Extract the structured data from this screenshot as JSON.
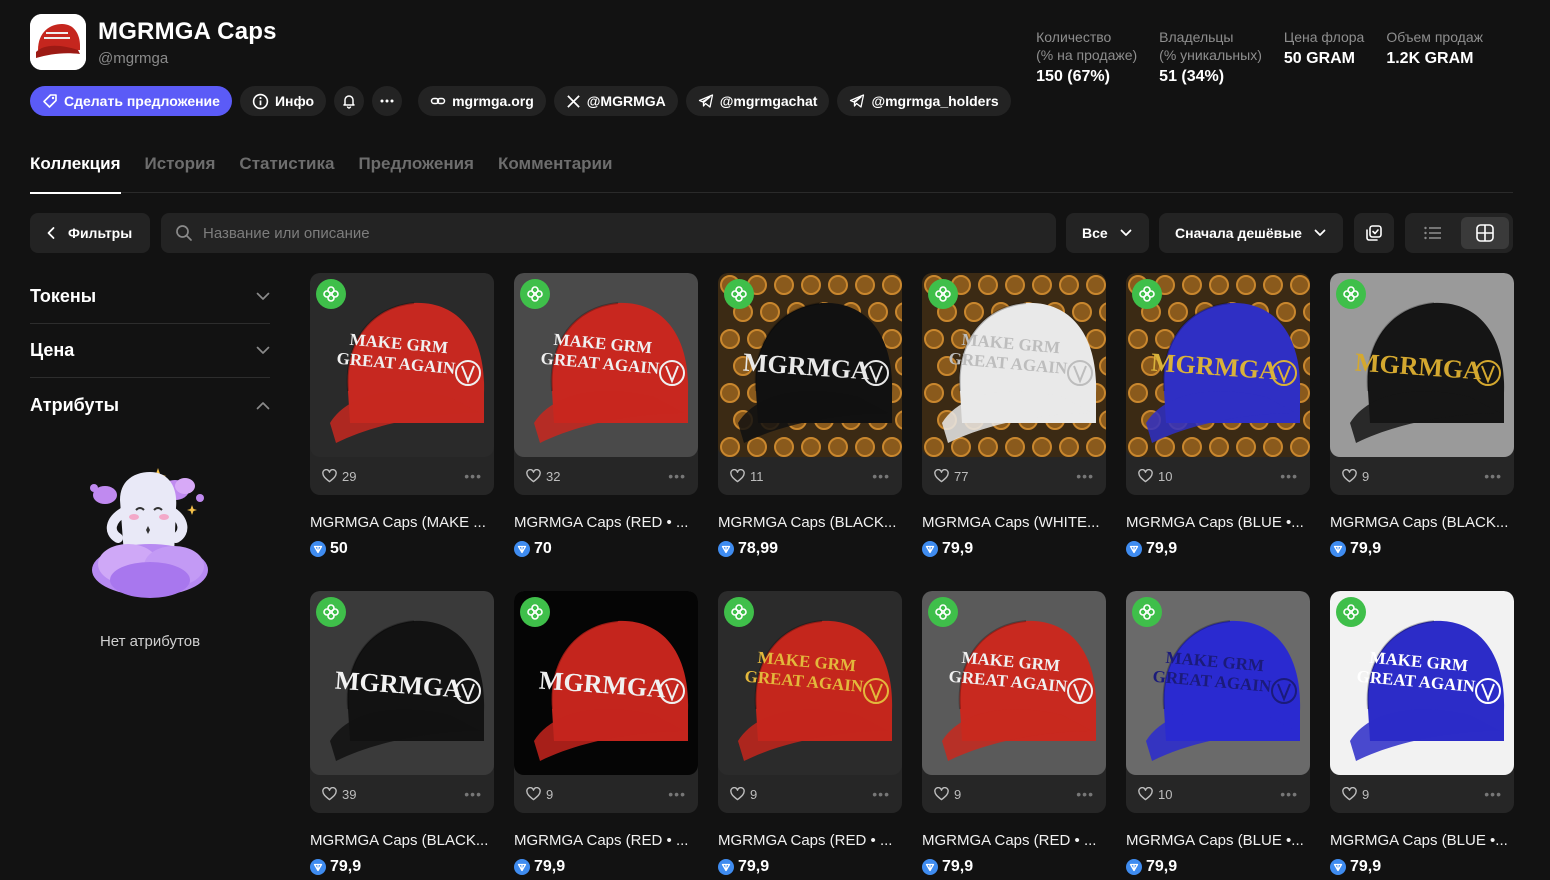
{
  "collection": {
    "name": "MGRMGA Caps",
    "handle": "@mgrmga",
    "logo_icon": "red-cap-logo"
  },
  "stats": [
    {
      "label": "Количество\n(% на продаже)",
      "value": "150 (67%)"
    },
    {
      "label": "Владельцы\n(% уникальных)",
      "value": "51 (34%)"
    },
    {
      "label": "Цена флора",
      "value": "50 GRAM"
    },
    {
      "label": "Объем продаж",
      "value": "1.2K GRAM"
    }
  ],
  "actions": {
    "offer": "Сделать предложение",
    "info": "Инфо",
    "links": [
      {
        "label": "mgrmga.org",
        "icon": "link-icon"
      },
      {
        "label": "@MGRMGA",
        "icon": "x-icon"
      },
      {
        "label": "@mgrmgachat",
        "icon": "telegram-icon"
      },
      {
        "label": "@mgrmga_holders",
        "icon": "telegram-icon"
      }
    ]
  },
  "tabs": [
    "Коллекция",
    "История",
    "Статистика",
    "Предложения",
    "Комментарии"
  ],
  "toolbar": {
    "filters": "Фильтры",
    "search_placeholder": "Название или описание",
    "filter_all": "Все",
    "sort": "Сначала дешёвые"
  },
  "sidebar": {
    "sections": [
      "Токены",
      "Цена",
      "Атрибуты"
    ],
    "empty_label": "Нет атрибутов"
  },
  "colors": {
    "accent": "#5b5bf7",
    "badge": "#3fbf4a",
    "ton": "#3f8cf0",
    "background": "#121212",
    "surface": "#232323"
  },
  "items": [
    {
      "name": "MGRMGA Caps (MAKE ...",
      "likes": "29",
      "price": "50",
      "cap": "#c62820",
      "bg": "#2a2a2a",
      "text": "MAKE GRM GREAT AGAIN",
      "textColor": "#f0f0f0",
      "pattern": false
    },
    {
      "name": "MGRMGA Caps (RED • ...",
      "likes": "32",
      "price": "70",
      "cap": "#c8271f",
      "bg": "#4a4a4a",
      "text": "MAKE GRM GREAT AGAIN",
      "textColor": "#f0f0f0",
      "pattern": false
    },
    {
      "name": "MGRMGA Caps (BLACK...",
      "likes": "11",
      "price": "78,99",
      "cap": "#111111",
      "bg": "#3b2a14",
      "text": "MGRMGA",
      "textColor": "#e8e8e8",
      "pattern": true
    },
    {
      "name": "MGRMGA Caps (WHITE...",
      "likes": "77",
      "price": "79,9",
      "cap": "#e9e9e9",
      "bg": "#3b2a14",
      "text": "MAKE GRM GREAT AGAIN",
      "textColor": "#bdbdbd",
      "pattern": true
    },
    {
      "name": "MGRMGA Caps (BLUE •...",
      "likes": "10",
      "price": "79,9",
      "cap": "#2f2fc4",
      "bg": "#3b2a14",
      "text": "MGRMGA",
      "textColor": "#d9b23a",
      "pattern": true
    },
    {
      "name": "MGRMGA Caps (BLACK...",
      "likes": "9",
      "price": "79,9",
      "cap": "#151515",
      "bg": "#9a9a9a",
      "text": "MGRMGA",
      "textColor": "#d4a82f",
      "pattern": false
    },
    {
      "name": "MGRMGA Caps (BLACK...",
      "likes": "39",
      "price": "79,9",
      "cap": "#121212",
      "bg": "#3a3a3a",
      "text": "MGRMGA",
      "textColor": "#f2f2f2",
      "pattern": false
    },
    {
      "name": "MGRMGA Caps (RED • ...",
      "likes": "9",
      "price": "79,9",
      "cap": "#c4251d",
      "bg": "#050505",
      "text": "MGRMGA",
      "textColor": "#f0f0f0",
      "pattern": false
    },
    {
      "name": "MGRMGA Caps (RED • ...",
      "likes": "9",
      "price": "79,9",
      "cap": "#c4261c",
      "bg": "#2b2b2b",
      "text": "MAKE GRM GREAT AGAIN",
      "textColor": "#e3b83c",
      "pattern": false
    },
    {
      "name": "MGRMGA Caps (RED • ...",
      "likes": "9",
      "price": "79,9",
      "cap": "#c8291f",
      "bg": "#5a5a5a",
      "text": "MAKE GRM GREAT AGAIN",
      "textColor": "#f0f0f0",
      "pattern": false
    },
    {
      "name": "MGRMGA Caps (BLUE •...",
      "likes": "10",
      "price": "79,9",
      "cap": "#2a2ad0",
      "bg": "#6a6a6a",
      "text": "MAKE GRM GREAT AGAIN",
      "textColor": "#1b1b7a",
      "pattern": false
    },
    {
      "name": "MGRMGA Caps (BLUE •...",
      "likes": "9",
      "price": "79,9",
      "cap": "#2c2cc8",
      "bg": "#f2f2f2",
      "text": "MAKE GRM GREAT AGAIN",
      "textColor": "#ffffff",
      "pattern": false
    }
  ]
}
